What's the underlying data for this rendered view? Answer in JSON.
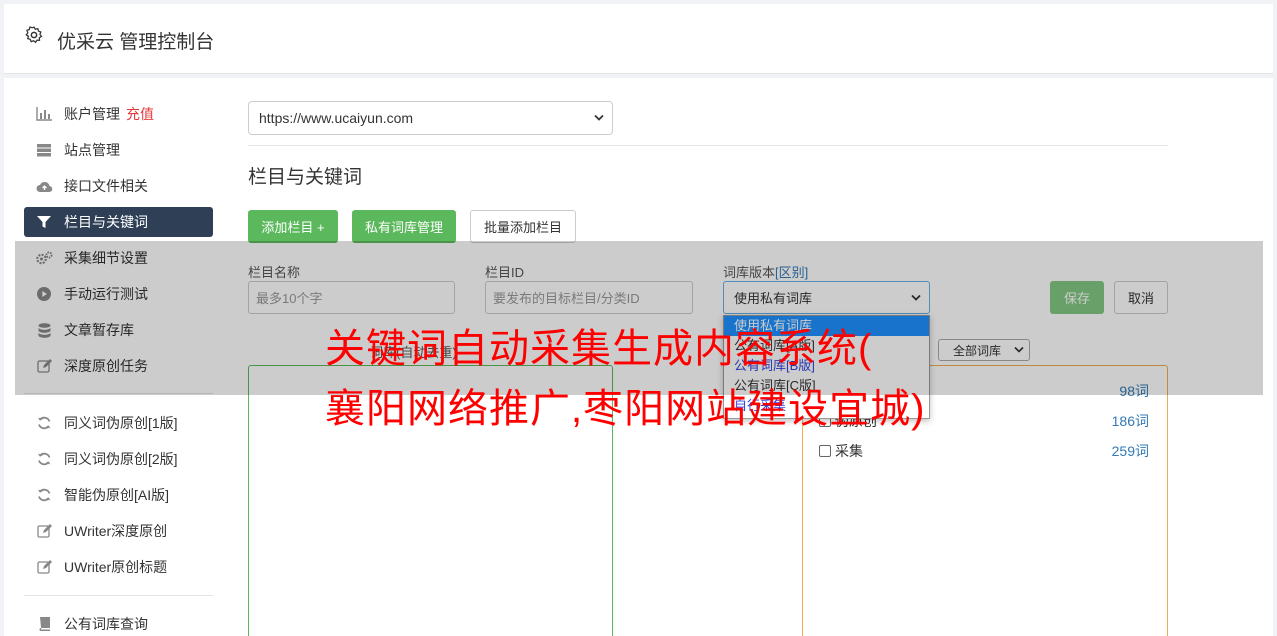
{
  "header": {
    "title": "优采云 管理控制台",
    "icon": "gear-icon"
  },
  "sidebar": {
    "items": [
      {
        "label": "账户管理",
        "badge": "充值",
        "icon": "bar-chart-icon"
      },
      {
        "label": "站点管理",
        "icon": "server-icon"
      },
      {
        "label": "接口文件相关",
        "icon": "cloud-upload-icon"
      },
      {
        "label": "栏目与关键词",
        "icon": "filter-icon",
        "active": true
      },
      {
        "label": "采集细节设置",
        "icon": "gears-icon"
      },
      {
        "label": "手动运行测试",
        "icon": "play-circle-icon"
      },
      {
        "label": "文章暂存库",
        "icon": "database-icon"
      },
      {
        "label": "深度原创任务",
        "icon": "edit-icon"
      },
      {
        "label": "同义词伪原创[1版]",
        "icon": "refresh-icon"
      },
      {
        "label": "同义词伪原创[2版]",
        "icon": "refresh-icon"
      },
      {
        "label": "智能伪原创[AI版]",
        "icon": "refresh-icon"
      },
      {
        "label": "UWriter深度原创",
        "icon": "edit-icon"
      },
      {
        "label": "UWriter原创标题",
        "icon": "edit-icon"
      },
      {
        "label": "公有词库查询",
        "icon": "book-icon"
      }
    ]
  },
  "main": {
    "site_select": "https://www.ucaiyun.com",
    "section_title": "栏目与关键词",
    "buttons": {
      "add_column": "添加栏目 +",
      "private_lib": "私有词库管理",
      "batch_add": "批量添加栏目"
    },
    "form": {
      "name_label": "栏目名称",
      "name_placeholder": "最多10个字",
      "id_label": "栏目ID",
      "id_placeholder": "要发布的目标栏目/分类ID",
      "lib_label": "词库版本",
      "lib_diff_link": "[区别]",
      "lib_value": "使用私有词库",
      "save": "保存",
      "cancel": "取消"
    },
    "dropdown_options": [
      "使用私有词库",
      "公有词库[A版]",
      "公有词库[B版]",
      "公有词库[C版]",
      "自行采集"
    ],
    "note": "词库(自动去重)",
    "all_libs_select": "全部词库",
    "libraries": [
      {
        "name": "",
        "count": "98词"
      },
      {
        "name": "伪原创",
        "count": "186词"
      },
      {
        "name": "采集",
        "count": "259词"
      }
    ]
  },
  "watermark": {
    "line1": "关键词自动采集生成内容系统(",
    "line2": "襄阳网络推广,枣阳网站建设宜城)"
  },
  "colors": {
    "accent_green": "#5cb85c",
    "sidebar_active": "#2f4056",
    "link_blue": "#337ab7",
    "watermark_red": "#ff0000"
  }
}
